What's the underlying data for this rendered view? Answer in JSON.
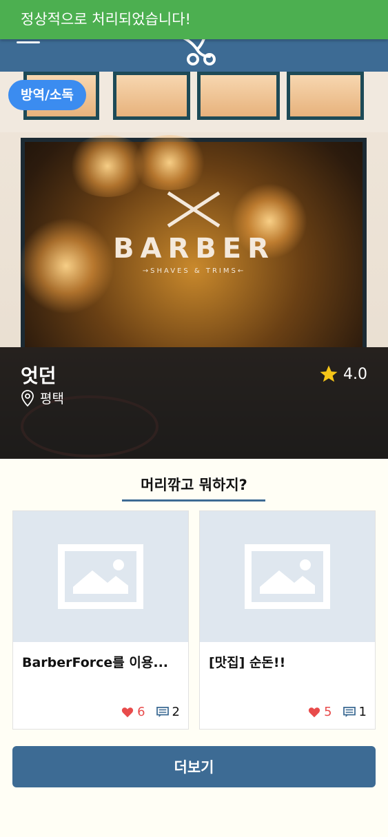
{
  "toast": {
    "message": "정상적으로 처리되었습니다!"
  },
  "header": {
    "menu_icon": "hamburger-menu-icon",
    "logo_icon": "scissors-logo-icon"
  },
  "hero": {
    "badge": "방역/소독",
    "sign_title": "BARBER",
    "sign_subtitle": "→SHAVES & TRIMS←",
    "shop_name": "엇던",
    "location": "평택",
    "rating": "4.0",
    "rating_icon": "star-icon",
    "location_icon": "map-pin-icon"
  },
  "section": {
    "title": "머리깎고 뭐하지?",
    "cards": [
      {
        "title": "BarberForce를 이용...",
        "likes": "6",
        "comments": "2"
      },
      {
        "title": "[맛집] 순돈!!",
        "likes": "5",
        "comments": "1"
      }
    ]
  },
  "more_button": {
    "label": "더보기"
  },
  "colors": {
    "header": "#3d6b94",
    "toast": "#4caf50",
    "badge": "#3b8cf0",
    "like": "#e84b4b",
    "page_bg": "#fffef5"
  }
}
